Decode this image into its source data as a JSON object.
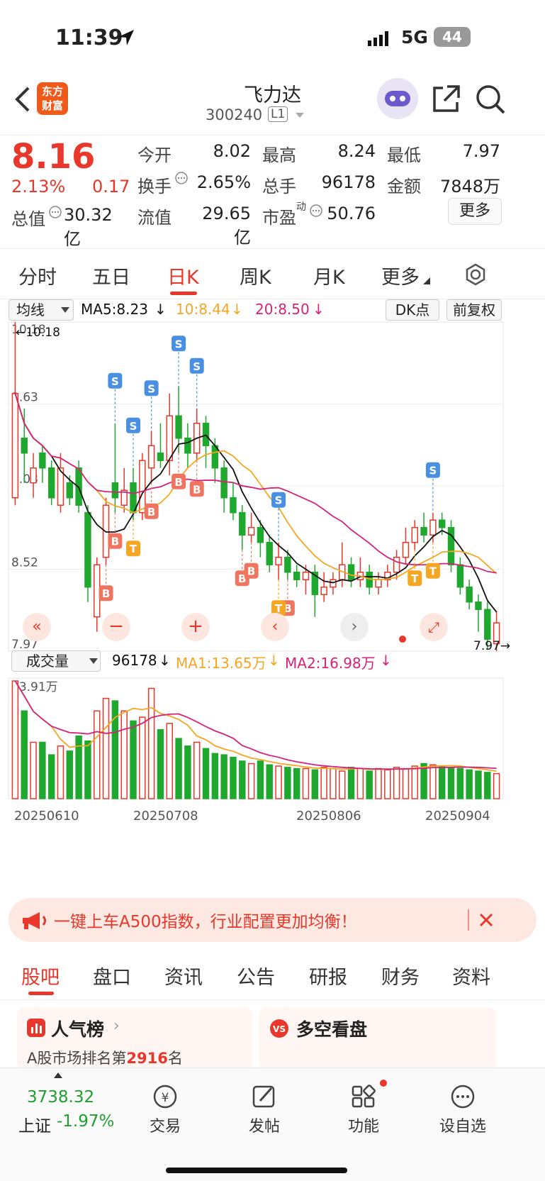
{
  "status_bar": {
    "time": "11:39",
    "network": "5G",
    "battery": "44"
  },
  "header": {
    "brand_line1": "东方",
    "brand_line2": "财富",
    "title": "飞力达",
    "code": "300240",
    "level": "L1"
  },
  "quote": {
    "price": "8.16",
    "change_pct": "2.13%",
    "change_amt": "0.17",
    "open_label": "今开",
    "open": "8.02",
    "high_label": "最高",
    "high": "8.24",
    "low_label": "最低",
    "low": "7.97",
    "turnover_label": "换手",
    "turnover": "2.65%",
    "volume_label": "总手",
    "volume": "96178",
    "amount_label": "金额",
    "amount": "7848万",
    "mcap_label": "总值",
    "mcap": "30.32亿",
    "float_label": "流值",
    "float_mcap": "29.65亿",
    "pe_label": "市盈",
    "pe_sup": "动",
    "pe": "50.76",
    "more_button": "更多"
  },
  "period_tabs": [
    "分时",
    "五日",
    "日K",
    "周K",
    "月K",
    "更多"
  ],
  "active_tab": "日K",
  "indicators": {
    "ma_select": "均线",
    "ma5": "MA5:8.23",
    "ma10": "10:8.44",
    "ma20": "20:8.50",
    "dk_button": "DK点",
    "adjust_button": "前复权"
  },
  "volume_panel": {
    "select": "成交量",
    "volume": "96178",
    "ma1": "MA1:13.65万",
    "ma2": "MA2:16.98万",
    "max_label": "93.91万"
  },
  "chart_data": {
    "type": "candlestick",
    "price_axis_labels": [
      "10.18",
      "9.63",
      "9.08",
      "8.52",
      "7.97"
    ],
    "high_marker": "10.18",
    "low_marker": "7.97",
    "date_labels": [
      "20250610",
      "20250708",
      "20250806",
      "20250904"
    ],
    "candles": [
      {
        "o": 9.0,
        "c": 9.7,
        "h": 10.18,
        "l": 8.95
      },
      {
        "o": 9.4,
        "c": 9.3,
        "h": 9.6,
        "l": 9.1
      },
      {
        "o": 9.1,
        "c": 9.2,
        "h": 9.3,
        "l": 9.0
      },
      {
        "o": 9.3,
        "c": 9.2,
        "h": 9.35,
        "l": 9.1
      },
      {
        "o": 9.2,
        "c": 9.0,
        "h": 9.25,
        "l": 8.95
      },
      {
        "o": 8.95,
        "c": 9.2,
        "h": 9.3,
        "l": 8.9
      },
      {
        "o": 9.1,
        "c": 9.0,
        "h": 9.15,
        "l": 8.95
      },
      {
        "o": 9.2,
        "c": 8.95,
        "h": 9.25,
        "l": 8.9
      },
      {
        "o": 8.9,
        "c": 8.4,
        "h": 8.95,
        "l": 8.3
      },
      {
        "o": 8.2,
        "c": 8.55,
        "h": 8.6,
        "l": 8.1
      },
      {
        "o": 8.6,
        "c": 8.95,
        "h": 9.0,
        "l": 8.55
      },
      {
        "o": 9.1,
        "c": 9.0,
        "h": 9.5,
        "l": 8.9
      },
      {
        "o": 8.95,
        "c": 9.05,
        "h": 9.2,
        "l": 8.9
      },
      {
        "o": 9.1,
        "c": 8.9,
        "h": 9.2,
        "l": 8.85
      },
      {
        "o": 8.9,
        "c": 9.25,
        "h": 9.3,
        "l": 8.85
      },
      {
        "o": 9.2,
        "c": 9.35,
        "h": 9.45,
        "l": 9.1
      },
      {
        "o": 9.3,
        "c": 9.25,
        "h": 9.5,
        "l": 9.2
      },
      {
        "o": 9.25,
        "c": 9.55,
        "h": 9.7,
        "l": 9.15
      },
      {
        "o": 9.55,
        "c": 9.4,
        "h": 9.75,
        "l": 9.3
      },
      {
        "o": 9.4,
        "c": 9.3,
        "h": 9.5,
        "l": 9.2
      },
      {
        "o": 9.3,
        "c": 9.5,
        "h": 9.6,
        "l": 9.25
      },
      {
        "o": 9.5,
        "c": 9.35,
        "h": 9.55,
        "l": 9.2
      },
      {
        "o": 9.35,
        "c": 9.2,
        "h": 9.4,
        "l": 9.1
      },
      {
        "o": 9.2,
        "c": 9.0,
        "h": 9.25,
        "l": 8.9
      },
      {
        "o": 9.0,
        "c": 8.9,
        "h": 9.1,
        "l": 8.85
      },
      {
        "o": 8.9,
        "c": 8.75,
        "h": 8.95,
        "l": 8.65
      },
      {
        "o": 8.75,
        "c": 8.8,
        "h": 8.9,
        "l": 8.7
      },
      {
        "o": 8.8,
        "c": 8.7,
        "h": 8.85,
        "l": 8.6
      },
      {
        "o": 8.7,
        "c": 8.55,
        "h": 8.75,
        "l": 8.5
      },
      {
        "o": 8.55,
        "c": 8.6,
        "h": 8.7,
        "l": 8.45
      },
      {
        "o": 8.6,
        "c": 8.5,
        "h": 8.65,
        "l": 8.45
      },
      {
        "o": 8.5,
        "c": 8.45,
        "h": 8.55,
        "l": 8.4
      },
      {
        "o": 8.45,
        "c": 8.5,
        "h": 8.55,
        "l": 8.35
      },
      {
        "o": 8.5,
        "c": 8.35,
        "h": 8.55,
        "l": 8.2
      },
      {
        "o": 8.35,
        "c": 8.4,
        "h": 8.5,
        "l": 8.3
      },
      {
        "o": 8.4,
        "c": 8.45,
        "h": 8.5,
        "l": 8.35
      },
      {
        "o": 8.45,
        "c": 8.55,
        "h": 8.7,
        "l": 8.4
      },
      {
        "o": 8.55,
        "c": 8.45,
        "h": 8.6,
        "l": 8.4
      },
      {
        "o": 8.45,
        "c": 8.5,
        "h": 8.6,
        "l": 8.4
      },
      {
        "o": 8.5,
        "c": 8.4,
        "h": 8.55,
        "l": 8.35
      },
      {
        "o": 8.4,
        "c": 8.45,
        "h": 8.5,
        "l": 8.35
      },
      {
        "o": 8.45,
        "c": 8.5,
        "h": 8.55,
        "l": 8.4
      },
      {
        "o": 8.5,
        "c": 8.6,
        "h": 8.65,
        "l": 8.45
      },
      {
        "o": 8.6,
        "c": 8.7,
        "h": 8.8,
        "l": 8.55
      },
      {
        "o": 8.7,
        "c": 8.8,
        "h": 8.85,
        "l": 8.65
      },
      {
        "o": 8.8,
        "c": 8.75,
        "h": 8.9,
        "l": 8.7
      },
      {
        "o": 8.75,
        "c": 8.85,
        "h": 8.9,
        "l": 8.7
      },
      {
        "o": 8.85,
        "c": 8.8,
        "h": 8.9,
        "l": 8.75
      },
      {
        "o": 8.8,
        "c": 8.55,
        "h": 8.85,
        "l": 8.5
      },
      {
        "o": 8.55,
        "c": 8.4,
        "h": 8.6,
        "l": 8.35
      },
      {
        "o": 8.4,
        "c": 8.3,
        "h": 8.45,
        "l": 8.25
      },
      {
        "o": 8.3,
        "c": 8.25,
        "h": 8.35,
        "l": 8.1
      },
      {
        "o": 8.25,
        "c": 8.05,
        "h": 8.3,
        "l": 7.98
      },
      {
        "o": 8.02,
        "c": 8.16,
        "h": 8.24,
        "l": 7.97
      }
    ],
    "ma5_color": "#111111",
    "ma10_color": "#f5a623",
    "ma20_color": "#d4237a",
    "up_color": "#e8372b",
    "down_color": "#1fa82e",
    "signals": [
      {
        "i": 11,
        "t": "S"
      },
      {
        "i": 13,
        "t": "S"
      },
      {
        "i": 15,
        "t": "S"
      },
      {
        "i": 18,
        "t": "S"
      },
      {
        "i": 20,
        "t": "S"
      },
      {
        "i": 29,
        "t": "S"
      },
      {
        "i": 46,
        "t": "S"
      },
      {
        "i": 10,
        "t": "B"
      },
      {
        "i": 11,
        "t": "B"
      },
      {
        "i": 15,
        "t": "B"
      },
      {
        "i": 18,
        "t": "B"
      },
      {
        "i": 20,
        "t": "B"
      },
      {
        "i": 25,
        "t": "B"
      },
      {
        "i": 26,
        "t": "B"
      },
      {
        "i": 30,
        "t": "B"
      },
      {
        "i": 13,
        "t": "T"
      },
      {
        "i": 29,
        "t": "T"
      },
      {
        "i": 44,
        "t": "T"
      },
      {
        "i": 46,
        "t": "T"
      }
    ],
    "volumes": [
      93.91,
      70,
      45,
      45,
      35,
      42,
      38,
      50,
      46,
      70,
      80,
      78,
      70,
      62,
      65,
      88,
      55,
      60,
      48,
      42,
      45,
      40,
      36,
      35,
      33,
      30,
      28,
      30,
      27,
      26,
      25,
      24,
      24,
      23,
      25,
      24,
      22,
      25,
      24,
      22,
      24,
      23,
      25,
      24,
      26,
      28,
      27,
      26,
      25,
      24,
      23,
      22,
      21,
      20
    ]
  },
  "banner": {
    "text": "一键上车A500指数，行业配置更加均衡！"
  },
  "content_tabs": [
    "股吧",
    "盘口",
    "资讯",
    "公告",
    "研报",
    "财务",
    "资料"
  ],
  "active_content_tab": "股吧",
  "cards": {
    "popular_title": "人气榜",
    "popular_rank_prefix": "A股市场排名第",
    "popular_rank": "2916",
    "popular_rank_suffix": "名",
    "bullbear_title": "多空看盘"
  },
  "bottom_bar": {
    "index_value": "3738.32",
    "index_name": "上证",
    "index_change": "-1.97%",
    "trade": "交易",
    "post": "发帖",
    "function": "功能",
    "watchlist": "设自选"
  }
}
